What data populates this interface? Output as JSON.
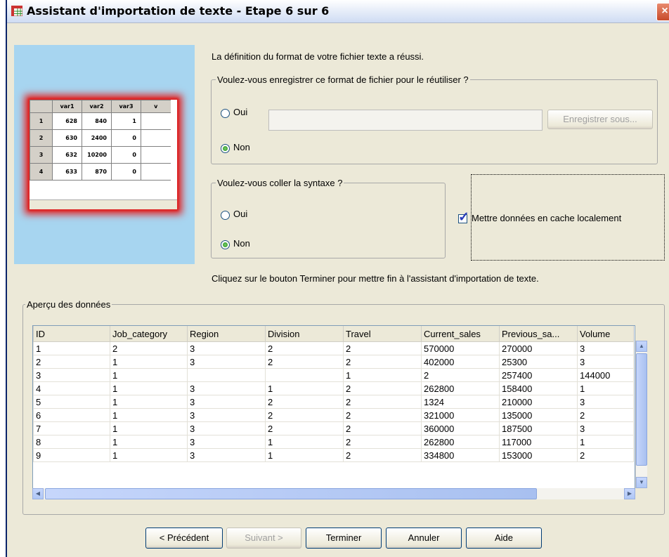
{
  "window": {
    "title": "Assistant d'importation de texte - Etape 6 sur 6",
    "close_label": "×"
  },
  "preview_image": {
    "headers": [
      "",
      "var1",
      "var2",
      "var3",
      "v"
    ],
    "rows": [
      [
        "1",
        "628",
        "840",
        "1"
      ],
      [
        "2",
        "630",
        "2400",
        "0"
      ],
      [
        "3",
        "632",
        "10200",
        "0"
      ],
      [
        "4",
        "633",
        "870",
        "0"
      ]
    ]
  },
  "intro_text": "La définition du format de votre fichier texte a réussi.",
  "save_format": {
    "legend": "Voulez-vous enregistrer ce format de fichier pour le réutiliser ?",
    "yes_label": "Oui",
    "no_label": "Non",
    "selected": "Non",
    "path_value": "",
    "save_as_label": "Enregistrer sous..."
  },
  "paste_syntax": {
    "legend": "Voulez-vous coller la syntaxe ?",
    "yes_label": "Oui",
    "no_label": "Non",
    "selected": "Non"
  },
  "cache_checkbox": {
    "label": "Mettre données en cache localement",
    "checked": true
  },
  "finish_hint": "Cliquez sur le bouton Terminer pour mettre fin à l'assistant d'importation de texte.",
  "data_preview": {
    "legend": "Aperçu des données",
    "columns": [
      "ID",
      "Job_category",
      "Region",
      "Division",
      "Travel",
      "Current_sales",
      "Previous_sa...",
      "Volume"
    ],
    "rows": [
      [
        "1",
        "2",
        "3",
        "2",
        "2",
        "570000",
        "270000",
        "3"
      ],
      [
        "2",
        "1",
        "3",
        "2",
        "2",
        "402000",
        "25300",
        "3"
      ],
      [
        "3",
        "1",
        "",
        "",
        "1",
        "2",
        "257400",
        "144000"
      ],
      [
        "4",
        "1",
        "3",
        "1",
        "2",
        "262800",
        "158400",
        "1"
      ],
      [
        "5",
        "1",
        "3",
        "2",
        "2",
        "1324",
        "210000",
        "3"
      ],
      [
        "6",
        "1",
        "3",
        "2",
        "2",
        "321000",
        "135000",
        "2"
      ],
      [
        "7",
        "1",
        "3",
        "2",
        "2",
        "360000",
        "187500",
        "3"
      ],
      [
        "8",
        "1",
        "3",
        "1",
        "2",
        "262800",
        "117000",
        "1"
      ],
      [
        "9",
        "1",
        "3",
        "1",
        "2",
        "334800",
        "153000",
        "2"
      ]
    ]
  },
  "buttons": {
    "previous": "< Précédent",
    "next": "Suivant >",
    "finish": "Terminer",
    "cancel": "Annuler",
    "help": "Aide"
  }
}
